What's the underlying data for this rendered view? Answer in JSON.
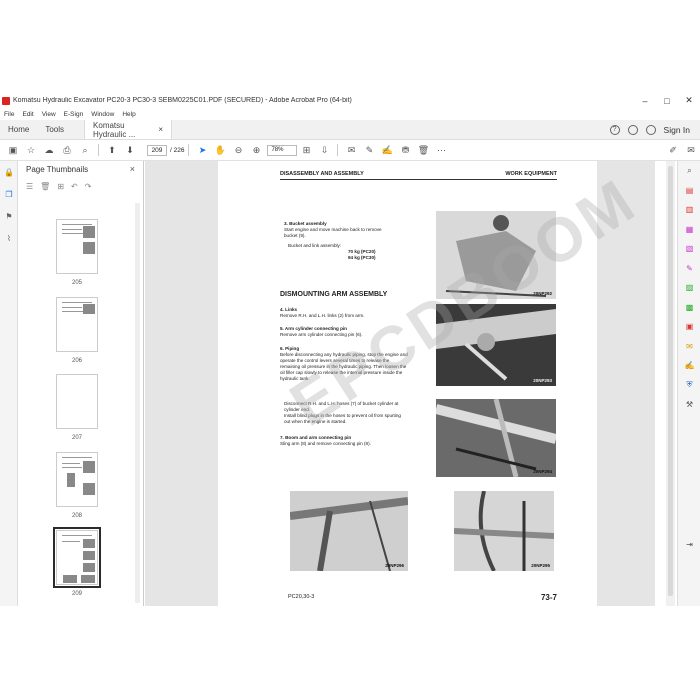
{
  "window": {
    "title": "Komatsu Hydraulic Excavator PC20-3 PC30-3 SEBM0225C01.PDF (SECURED) - Adobe Acrobat Pro (64-bit)",
    "minimize": "–",
    "maximize": "□",
    "close": "✕"
  },
  "menu": [
    "File",
    "Edit",
    "View",
    "E-Sign",
    "Window",
    "Help"
  ],
  "tabs": {
    "home": "Home",
    "tools": "Tools",
    "doc": "Komatsu Hydraulic ...",
    "doc_close": "×"
  },
  "header": {
    "sign_in": "Sign In",
    "help": "?",
    "bell": "🔔"
  },
  "toolbar": {
    "current_page": "209",
    "total_pages": "/ 226",
    "zoom": "78%"
  },
  "thumbnails": {
    "title": "Page Thumbnails",
    "close": "×",
    "pages": [
      {
        "label": "205",
        "blank": false,
        "selected": false
      },
      {
        "label": "206",
        "blank": false,
        "selected": false
      },
      {
        "label": "207",
        "blank": true,
        "selected": false
      },
      {
        "label": "208",
        "blank": false,
        "selected": false
      },
      {
        "label": "209",
        "blank": false,
        "selected": true
      }
    ]
  },
  "document": {
    "header_left": "DISASSEMBLY AND ASSEMBLY",
    "header_right": "WORK EQUIPMENT",
    "step3_title": "3. Bucket assembly",
    "step3_text": "Start engine and move machine back to remove bucket (9).",
    "weight_label": "Bucket and link assembly:",
    "weight_pc20": "70 kg (PC20)",
    "weight_pc30": "94 kg (PC30)",
    "section_heading": "DISMOUNTING ARM ASSEMBLY",
    "step4_title": "4. Links",
    "step4_text": "Remove R.H. and L.H. links (2) from arm.",
    "step5_title": "5. Arm cylinder connecting pin",
    "step5_text": "Remove arm cylinder connecting pin (6).",
    "step6_title": "6. Piping",
    "step6_text": "Before disconnecting any hydraulic piping, stop the engine and operate the control levers several times to release the remaining oil pressure in the hydraulic piping. Then loosen the oil filler cap slowly to release the internal pressure inside the hydraulic tank.",
    "step6_text2": "Disconnect R.H. and L.H. hoses (7) of bucket cylinder at cylinder end.",
    "step6_bullet": "Install blind plugs in the hoses to prevent oil from spurting out when the engine is started.",
    "step7_title": "7. Boom and arm connecting pin",
    "step7_text": "Sling arm (8) and remove connecting pin (8).",
    "photo_captions": [
      "20NP292",
      "20NP293",
      "20NP294",
      "20NP296",
      "20NP295"
    ],
    "footer_left": "PC20,30-3",
    "footer_right": "73-7",
    "watermark": "EPCDBOOM"
  }
}
